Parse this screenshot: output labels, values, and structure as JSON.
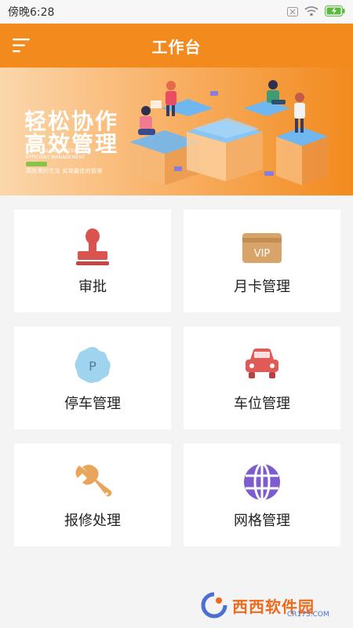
{
  "status_bar": {
    "time": "傍晚6:28"
  },
  "header": {
    "title": "工作台"
  },
  "banner": {
    "headline_line1": "轻松协作",
    "headline_line2": "高效管理",
    "tagline": "高效率的方法 实现最佳的管理",
    "subtitle_en": "EASY COLLABORATION AND EFFICIENT MANAGEMENT"
  },
  "menu": [
    {
      "label": "审批",
      "icon": "stamp-icon"
    },
    {
      "label": "月卡管理",
      "icon": "vip-card-icon"
    },
    {
      "label": "停车管理",
      "icon": "parking-icon"
    },
    {
      "label": "车位管理",
      "icon": "car-icon"
    },
    {
      "label": "报修处理",
      "icon": "wrench-icon"
    },
    {
      "label": "网格管理",
      "icon": "grid-globe-icon"
    }
  ],
  "watermark": {
    "brand": "西西软件园",
    "site": "CR173.COM"
  },
  "colors": {
    "accent": "#f28a1e",
    "stamp": "#d9534f",
    "vip": "#d9a46a",
    "parking": "#9fd4ee",
    "car": "#e05a57",
    "wrench": "#e9a55c",
    "globe": "#7c5ccf"
  }
}
